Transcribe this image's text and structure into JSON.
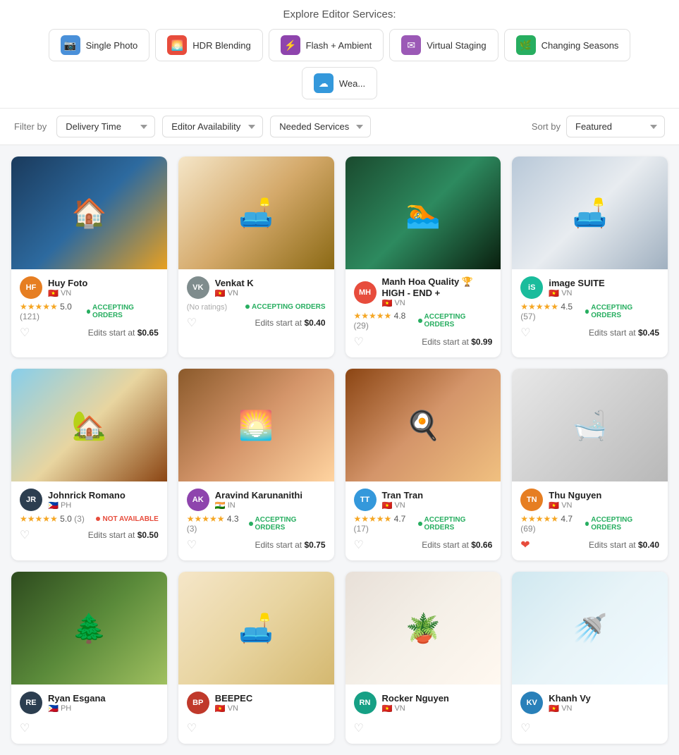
{
  "header": {
    "explore_title": "Explore Editor Services:",
    "service_tabs": [
      {
        "id": "single-photo",
        "label": "Single Photo",
        "icon": "📷",
        "color": "#4a90d9"
      },
      {
        "id": "hdr-blending",
        "label": "HDR Blending",
        "icon": "🌅",
        "color": "#e74c3c"
      },
      {
        "id": "flash-ambient",
        "label": "Flash + Ambient",
        "icon": "⚡",
        "color": "#8e44ad"
      },
      {
        "id": "virtual-staging",
        "label": "Virtual Staging",
        "icon": "✉",
        "color": "#9b59b6"
      },
      {
        "id": "changing-seasons",
        "label": "Changing Seasons",
        "icon": "🌿",
        "color": "#27ae60"
      },
      {
        "id": "weather",
        "label": "Wea...",
        "icon": "☁",
        "color": "#3498db"
      }
    ]
  },
  "filters": {
    "filter_label": "Filter by",
    "delivery_time_label": "Delivery Time",
    "editor_availability_label": "Editor Availability",
    "needed_services_label": "Needed Services",
    "sort_label": "Sort by",
    "featured_label": "Featured"
  },
  "cards": [
    {
      "id": 1,
      "editor": "Huy Foto",
      "country": "VN",
      "flag": "🇻🇳",
      "rating": "5.0",
      "reviews": "(121)",
      "status": "ACCEPTING ORDERS",
      "status_type": "accepting",
      "price": "$0.65",
      "liked": false,
      "avatar_text": "HF",
      "avatar_color": "#e67e22",
      "img_class": "img-1"
    },
    {
      "id": 2,
      "editor": "Venkat K",
      "country": "VN",
      "flag": "🇻🇳",
      "rating": "",
      "reviews": "(No ratings)",
      "status": "ACCEPTING ORDERS",
      "status_type": "accepting",
      "price": "$0.40",
      "liked": false,
      "avatar_text": "VK",
      "avatar_color": "#7f8c8d",
      "img_class": "img-2"
    },
    {
      "id": 3,
      "editor": "Manh Hoa Quality 🏆HIGH - END +",
      "country": "VN",
      "flag": "🇻🇳",
      "rating": "4.8",
      "reviews": "(29)",
      "status": "ACCEPTING ORDERS",
      "status_type": "accepting",
      "price": "$0.99",
      "liked": false,
      "avatar_text": "MH",
      "avatar_color": "#e74c3c",
      "img_class": "img-3"
    },
    {
      "id": 4,
      "editor": "image SUITE",
      "country": "VN",
      "flag": "🇻🇳",
      "rating": "4.5",
      "reviews": "(57)",
      "status": "ACCEPTING ORDERS",
      "status_type": "accepting",
      "price": "$0.45",
      "liked": false,
      "avatar_text": "iS",
      "avatar_color": "#1abc9c",
      "img_class": "img-4"
    },
    {
      "id": 5,
      "editor": "Johnrick Romano",
      "country": "PH",
      "flag": "🇵🇭",
      "rating": "5.0",
      "reviews": "(3)",
      "status": "NOT AVAILABLE",
      "status_type": "not-available",
      "price": "$0.50",
      "liked": false,
      "avatar_text": "JR",
      "avatar_color": "#2c3e50",
      "img_class": "img-5"
    },
    {
      "id": 6,
      "editor": "Aravind Karunanithi",
      "country": "IN",
      "flag": "🇮🇳",
      "rating": "4.3",
      "reviews": "(3)",
      "status": "ACCEPTING ORDERS",
      "status_type": "accepting",
      "price": "$0.75",
      "liked": false,
      "avatar_text": "AK",
      "avatar_color": "#8e44ad",
      "img_class": "img-6"
    },
    {
      "id": 7,
      "editor": "Tran Tran",
      "country": "VN",
      "flag": "🇻🇳",
      "rating": "4.7",
      "reviews": "(17)",
      "status": "ACCEPTING ORDERS",
      "status_type": "accepting",
      "price": "$0.66",
      "liked": false,
      "avatar_text": "TT",
      "avatar_color": "#3498db",
      "img_class": "img-7"
    },
    {
      "id": 8,
      "editor": "Thu Nguyen",
      "country": "VN",
      "flag": "🇻🇳",
      "rating": "4.7",
      "reviews": "(69)",
      "status": "ACCEPTING ORDERS",
      "status_type": "accepting",
      "price": "$0.40",
      "liked": true,
      "avatar_text": "TN",
      "avatar_color": "#e67e22",
      "img_class": "img-8"
    },
    {
      "id": 9,
      "editor": "Ryan Esgana",
      "country": "PH",
      "flag": "🇵🇭",
      "rating": "",
      "reviews": "",
      "status": "",
      "status_type": "accepting",
      "price": "",
      "liked": false,
      "avatar_text": "RE",
      "avatar_color": "#2c3e50",
      "img_class": "img-9"
    },
    {
      "id": 10,
      "editor": "BEEPEC",
      "country": "VN",
      "flag": "🇻🇳",
      "rating": "",
      "reviews": "",
      "status": "",
      "status_type": "accepting",
      "price": "",
      "liked": false,
      "avatar_text": "BP",
      "avatar_color": "#c0392b",
      "img_class": "img-10"
    },
    {
      "id": 11,
      "editor": "Rocker Nguyen",
      "country": "VN",
      "flag": "🇻🇳",
      "rating": "",
      "reviews": "",
      "status": "",
      "status_type": "accepting",
      "price": "",
      "liked": false,
      "avatar_text": "RN",
      "avatar_color": "#16a085",
      "img_class": "img-11"
    },
    {
      "id": 12,
      "editor": "Khanh Vy",
      "country": "VN",
      "flag": "🇻🇳",
      "rating": "",
      "reviews": "",
      "status": "",
      "status_type": "accepting",
      "price": "",
      "liked": false,
      "avatar_text": "KV",
      "avatar_color": "#2980b9",
      "img_class": "img-12"
    }
  ]
}
